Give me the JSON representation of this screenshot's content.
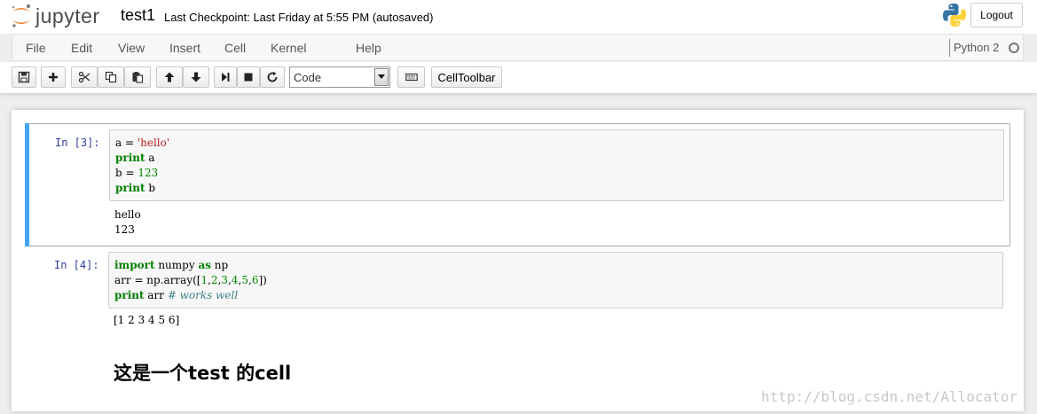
{
  "header": {
    "logo_text": "jupyter",
    "notebook_name": "test1",
    "checkpoint": "Last Checkpoint: Last Friday at 5:55 PM (autosaved)",
    "logout_label": "Logout"
  },
  "menubar": {
    "items": [
      "File",
      "Edit",
      "View",
      "Insert",
      "Cell",
      "Kernel",
      "Help"
    ],
    "kernel_name": "Python 2"
  },
  "toolbar": {
    "cell_type": "Code",
    "celltoolbar_label": "CellToolbar"
  },
  "cells": [
    {
      "prompt": "In  [3]:",
      "code": [
        "a = 'hello'",
        "print a",
        "b = 123",
        "print b"
      ],
      "output": [
        "hello",
        "123"
      ]
    },
    {
      "prompt": "In  [4]:",
      "code": [
        "import numpy as np",
        "arr = np.array([1,2,3,4,5,6])",
        "print arr # works well"
      ],
      "output": [
        "[1 2 3 4 5 6]"
      ]
    }
  ],
  "markdown": {
    "heading": "这是一个test 的cell"
  },
  "watermark": "http://blog.csdn.net/Allocator",
  "colors": {
    "selected_cell_bar": "#42a5f5",
    "keyword": "#008000",
    "string": "#ba2121",
    "prompt": "#303f9f"
  }
}
